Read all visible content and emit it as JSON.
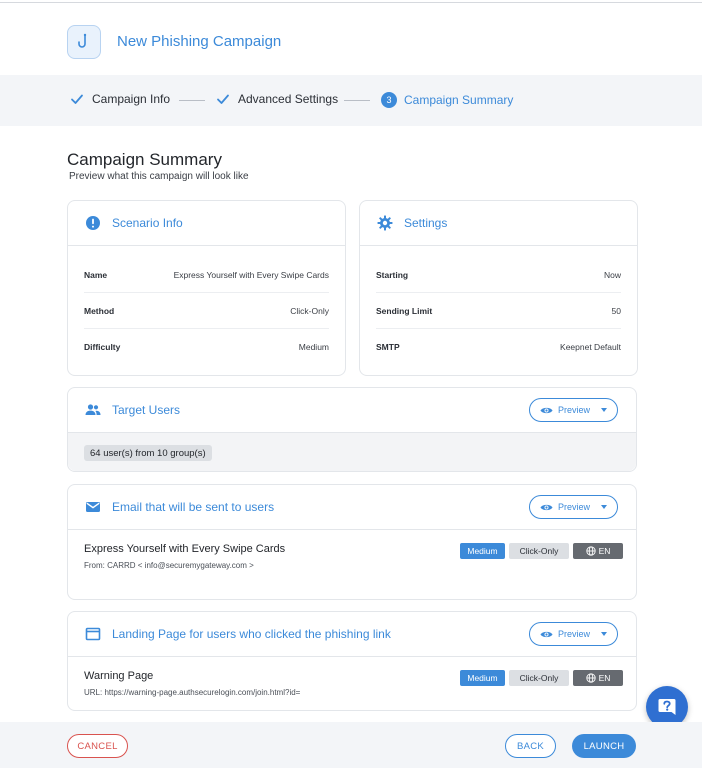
{
  "header": {
    "title": "New Phishing Campaign",
    "icon": "hook-icon"
  },
  "steps": [
    {
      "label": "Campaign Info",
      "state": "done"
    },
    {
      "label": "Advanced Settings",
      "state": "done"
    },
    {
      "number": "3",
      "label": "Campaign Summary",
      "state": "active"
    }
  ],
  "summary": {
    "title": "Campaign Summary",
    "subtitle": "Preview what this campaign will look like"
  },
  "scenario": {
    "title": "Scenario Info",
    "rows": [
      {
        "key": "Name",
        "value": "Express Yourself with Every Swipe Cards"
      },
      {
        "key": "Method",
        "value": "Click-Only"
      },
      {
        "key": "Difficulty",
        "value": "Medium"
      }
    ]
  },
  "settings": {
    "title": "Settings",
    "rows": [
      {
        "key": "Starting",
        "value": "Now"
      },
      {
        "key": "Sending Limit",
        "value": "50"
      },
      {
        "key": "SMTP",
        "value": "Keepnet Default"
      }
    ]
  },
  "target_users": {
    "title": "Target Users",
    "preview_label": "Preview",
    "chip": "64 user(s) from 10 group(s)"
  },
  "email": {
    "title": "Email that will be sent to users",
    "preview_label": "Preview",
    "name": "Express Yourself with Every Swipe Cards",
    "from": "From: CARRD < info@securemygateway.com >",
    "tags": {
      "difficulty": "Medium",
      "method": "Click-Only",
      "lang": "EN"
    }
  },
  "landing": {
    "title": "Landing Page for users who clicked the phishing link",
    "preview_label": "Preview",
    "name": "Warning Page",
    "url": "URL: https://warning-page.authsecurelogin.com/join.html?id=",
    "tags": {
      "difficulty": "Medium",
      "method": "Click-Only",
      "lang": "EN"
    }
  },
  "footer": {
    "cancel": "CANCEL",
    "back": "BACK",
    "launch": "LAUNCH"
  },
  "colors": {
    "accent": "#3c8ad9",
    "danger": "#d9534f",
    "fab": "#2f6fd1"
  }
}
